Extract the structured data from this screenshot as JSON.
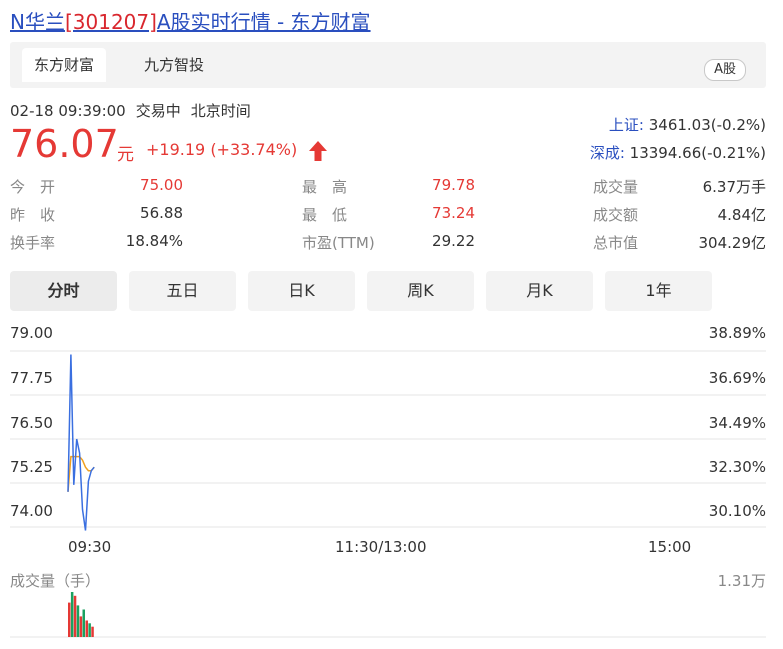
{
  "page": {
    "title_prefix": "N华兰",
    "title_code": "[301207]",
    "title_suffix": "A股实时行情 - 东方财富"
  },
  "source_tabs": [
    "东方财富",
    "九方智投"
  ],
  "market_badge": "A股",
  "status": {
    "datetime": "02-18 09:39:00",
    "state": "交易中",
    "timezone": "北京时间"
  },
  "quote": {
    "price": "76.07",
    "unit": "元",
    "change": "+19.19",
    "change_pct": "(+33.74%)"
  },
  "indices": [
    {
      "name": "上证:",
      "value": " 3461.03(-0.2%)"
    },
    {
      "name": "深成:",
      "value": " 13394.66(-0.21%)"
    }
  ],
  "stats": {
    "open_label": "今　开",
    "open": "75.00",
    "prev_label": "昨　收",
    "prev": "56.88",
    "turnover_label": "换手率",
    "turnover": "18.84%",
    "high_label": "最　高",
    "high": "79.78",
    "low_label": "最　低",
    "low": "73.24",
    "pe_label": "市盈(TTM)",
    "pe": "29.22",
    "volume_label": "成交量",
    "volume": "6.37万手",
    "amount_label": "成交额",
    "amount": "4.84亿",
    "mktcap_label": "总市值",
    "mktcap": "304.29亿"
  },
  "period_tabs": [
    "分时",
    "五日",
    "日K",
    "周K",
    "月K",
    "1年"
  ],
  "active_period": "分时",
  "chart_labels": {
    "y_left": [
      "79.00",
      "77.75",
      "76.50",
      "75.25",
      "74.00"
    ],
    "y_right": [
      "38.89%",
      "36.69%",
      "34.49%",
      "32.30%",
      "30.10%"
    ],
    "x": [
      "09:30",
      "11:30/13:00",
      "15:00"
    ],
    "volume_title": "成交量（手）",
    "volume_max": "1.31万"
  },
  "colors": {
    "up": "#e53935",
    "down": "#1aa260",
    "price_line": "#3a6fe0",
    "avg_line": "#f0a020",
    "link": "#2a4fbf"
  },
  "chart_data": {
    "type": "line",
    "x_range": [
      "09:30",
      "15:00"
    ],
    "ylim": [
      74.0,
      79.0
    ],
    "series": [
      {
        "x": [
          "09:30",
          "09:31",
          "09:32",
          "09:33",
          "09:34",
          "09:35",
          "09:36",
          "09:37",
          "09:38",
          "09:39"
        ],
        "values": [
          75.0,
          78.9,
          75.2,
          76.5,
          76.1,
          74.5,
          73.9,
          75.3,
          75.6,
          75.7
        ]
      },
      {
        "x": [
          "09:30",
          "09:31",
          "09:32",
          "09:33",
          "09:34",
          "09:35",
          "09:36",
          "09:37",
          "09:38",
          "09:39"
        ],
        "values": [
          75.0,
          76.0,
          76.0,
          76.0,
          76.0,
          75.9,
          75.7,
          75.6,
          75.6,
          75.7
        ]
      }
    ],
    "volume": {
      "ylim": [
        0,
        13100
      ],
      "values": [
        10000,
        13100,
        12000,
        9200,
        6000,
        8000,
        4800,
        4000,
        3000
      ],
      "directions": [
        "up",
        "down",
        "up",
        "down",
        "up",
        "down",
        "up",
        "down",
        "up"
      ]
    }
  }
}
